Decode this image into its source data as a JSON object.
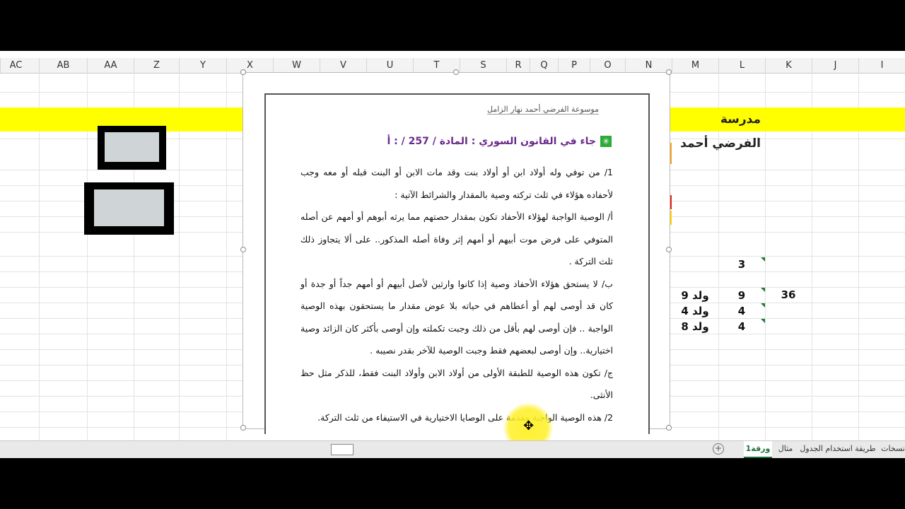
{
  "columns": [
    "AC",
    "AB",
    "AA",
    "Z",
    "Y",
    "X",
    "W",
    "V",
    "U",
    "T",
    "S",
    "R",
    "Q",
    "P",
    "O",
    "N",
    "M",
    "L",
    "K",
    "J",
    "I"
  ],
  "banner_text": "مدرسة الفرضي أحمد",
  "cells": {
    "l_top": "3",
    "k_val": "36",
    "l1": "9",
    "l2": "4",
    "l3": "4",
    "m1": "ولد 9",
    "m2": "ولد 4",
    "m3": "ولد 8"
  },
  "document": {
    "header": "موسوعة الفرضي أحمد نهار الزامل",
    "heading": "جاء في القانون السوري : المادة / 257 / : أ",
    "heading_icon": "green-star-box",
    "paragraphs": [
      "1/ من توفي وله أولاد ابن أو أولاد بنت وقد مات الابن أو البنت قبله أو معه وجب لأحفاده هؤلاء في ثلث تركته وصية بالمقدار والشرائط الآتية :",
      "أ/ الوصية الواجبة لهؤلاء الأحفاد تكون بمقدار حصتهم مما يرثه أبوهم أو أمهم عن أصله المتوفي على فرض موت أبيهم أو أمهم إثر وفاة أصله المذكور.. على ألا يتجاوز ذلك ثلث التركة .",
      "ب/ لا يستحق هؤلاء الأحفاد وصية إذا كانوا وارثين لأصل أبيهم أو أمهم جداً أو جدة أو كان قد أوصى لهم أو أعطاهم في حياته بلا عوض مقدار ما يستحقون بهذه الوصية الواجبة .. فإن أوصى لهم بأقل من ذلك وجبت تكملته وإن أوصى بأكثر كان الزائد وصية اختيارية.. وإن أوصى لبعضهم فقط وجبت الوصية للآخر بقدر نصيبه .",
      "ج/ تكون هذه الوصية للطبقة الأولى من أولاد الابن وأولاد البنت فقط، للذكر مثل حظ الأنثى.",
      "2/ هذه الوصية الواجبة مقدمة على الوصايا الاختيارية في الاستيفاء من ثلث التركة."
    ]
  },
  "sheet_tabs": [
    "ورقة1",
    "مثال",
    "طريقة استخدام الجدول",
    "نسخات"
  ],
  "active_tab": "ورقة1",
  "colors": {
    "banner": "#ffff00",
    "orange": "#f5a623",
    "red": "#e8201c",
    "active_tab": "#1d6f3a"
  }
}
